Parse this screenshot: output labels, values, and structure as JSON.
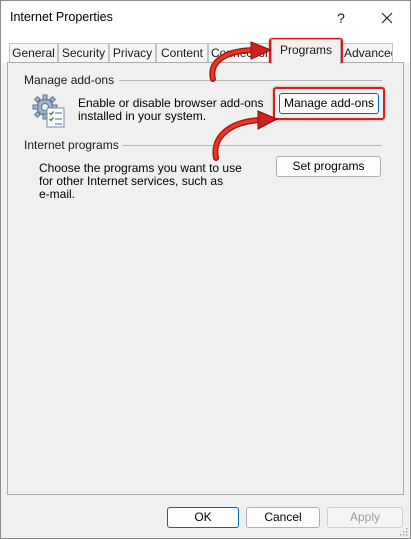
{
  "window": {
    "title": "Internet Properties",
    "help_glyph": "?"
  },
  "tabs": [
    {
      "label": "General",
      "active": false
    },
    {
      "label": "Security",
      "active": false
    },
    {
      "label": "Privacy",
      "active": false
    },
    {
      "label": "Content",
      "active": false
    },
    {
      "label": "Connections",
      "active": false
    },
    {
      "label": "Programs",
      "active": true
    },
    {
      "label": "Advanced",
      "active": false
    }
  ],
  "manage_addons": {
    "group_title": "Manage add-ons",
    "description_line1": "Enable or disable browser add-ons",
    "description_line2": "installed in your system.",
    "button_label": "Manage add-ons",
    "icon": "gear-checklist-icon"
  },
  "internet_programs": {
    "group_title": "Internet programs",
    "description_line1": "Choose the programs you want to use",
    "description_line2": "for other Internet services, such as",
    "description_line3": "e-mail.",
    "button_label": "Set programs"
  },
  "footer": {
    "ok_label": "OK",
    "cancel_label": "Cancel",
    "apply_label": "Apply"
  },
  "colors": {
    "annotation_red": "#d21f1f",
    "default_button_border": "#0067c0",
    "dialog_background": "#f0f0f0"
  }
}
